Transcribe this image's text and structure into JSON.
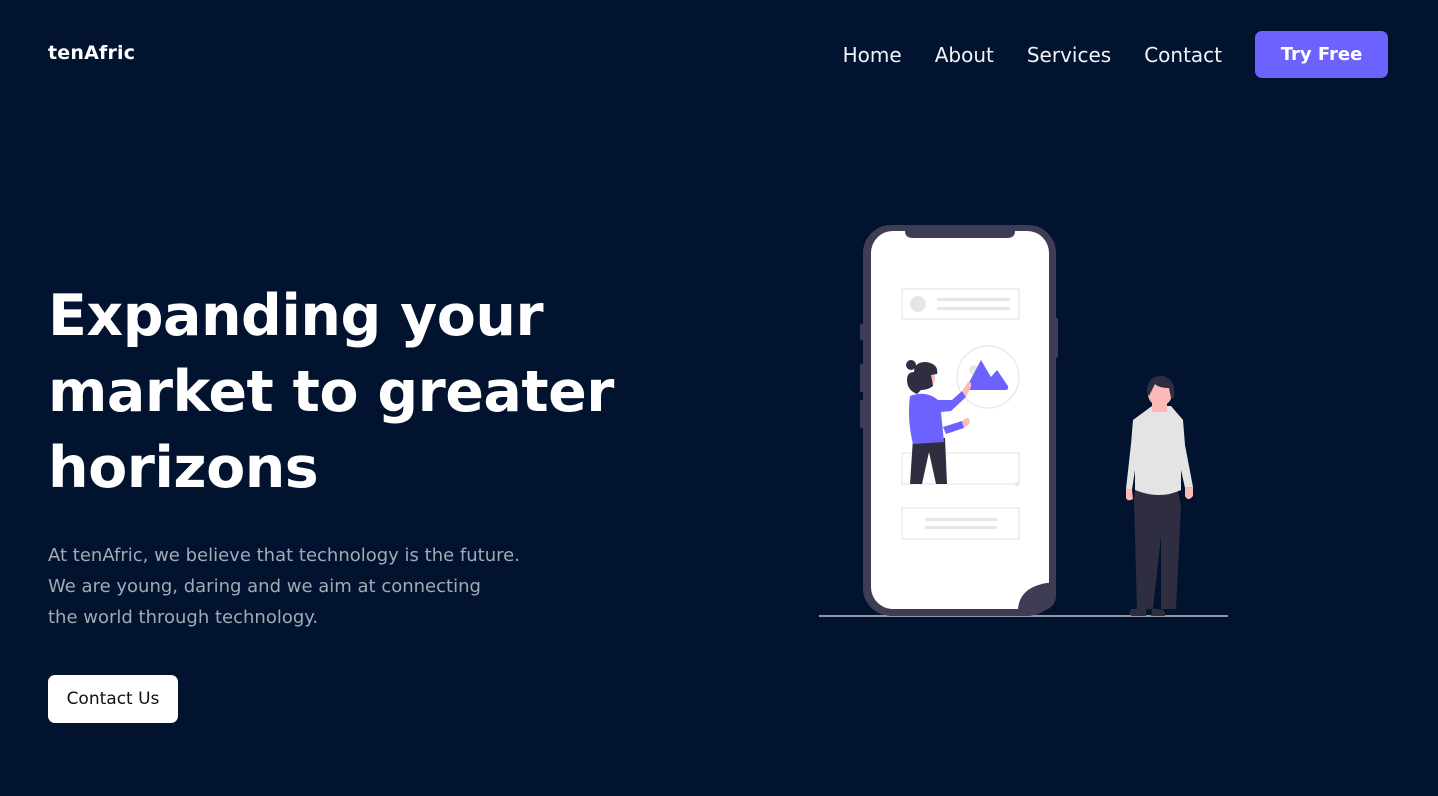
{
  "brand": {
    "name": "tenAfric"
  },
  "nav": {
    "links": [
      "Home",
      "About",
      "Services",
      "Contact"
    ],
    "cta_label": "Try Free"
  },
  "hero": {
    "title_lines": [
      "Expanding your",
      "market to greater",
      "horizons"
    ],
    "description_lines": [
      "At tenAfric, we believe that technology is the future.",
      "We are young, daring and we aim at connecting",
      "the world through technology."
    ],
    "cta_label": "Contact Us"
  },
  "colors": {
    "background": "#021330",
    "accent": "#6c63ff",
    "text_primary": "#ffffff",
    "text_muted": "#a3a9b5",
    "phone_frame": "#3f3d56"
  },
  "illustration": {
    "subject": "phone-with-people",
    "icons": [
      "mountain-image-icon",
      "avatar-placeholder-icon"
    ]
  }
}
